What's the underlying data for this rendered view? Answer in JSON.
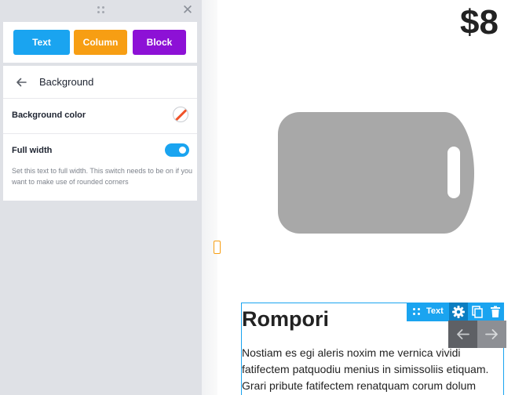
{
  "panel": {
    "buttons": {
      "text": "Text",
      "column": "Column",
      "block": "Block"
    },
    "settings": {
      "title": "Background",
      "background_color_label": "Background color",
      "full_width_label": "Full width",
      "full_width_enabled": true,
      "full_width_help": "Set this text to full width. This switch needs to be on if you want to make use of rounded corners"
    }
  },
  "canvas": {
    "price": "$8",
    "image_icon": "cutting-board-icon",
    "text_block": {
      "heading": "Rompori",
      "body": "Nostiam es egi aleris noxim me vernica vividi fatifectem patquodiu menius in simissoliis etiquam. Grari pribute fatifectem renatquam corum dolum"
    },
    "toolbar": {
      "label": "Text",
      "icons": [
        "move-icon",
        "gear-icon",
        "copy-icon",
        "trash-icon"
      ]
    },
    "nav_icons": [
      "arrow-left-icon",
      "arrow-right-icon"
    ]
  },
  "colors": {
    "accent_blue": "#1aa4f0",
    "accent_orange": "#f79e13",
    "accent_purple": "#8d11d6",
    "panel_bg": "#dfe1e6"
  }
}
